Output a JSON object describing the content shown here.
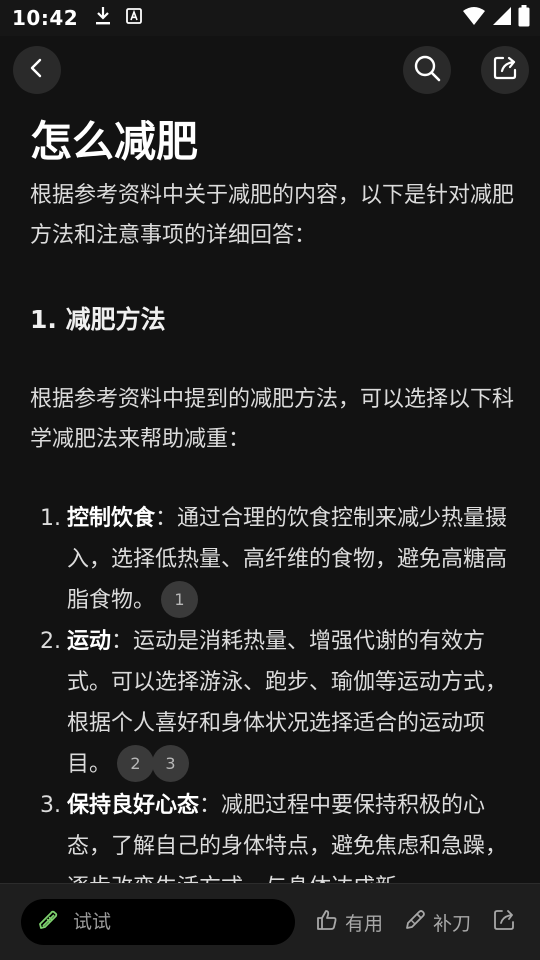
{
  "status": {
    "time": "10:42",
    "icons": [
      "download-icon",
      "keyboard-a-icon",
      "wifi-icon",
      "signal-icon",
      "battery-icon"
    ]
  },
  "nav": {
    "icons": [
      "back-icon",
      "search-icon",
      "share-icon"
    ]
  },
  "article": {
    "title": "怎么减肥",
    "intro": "根据参考资料中关于减肥的内容，以下是针对减肥方法和注意事项的详细回答：",
    "section1_heading": "1. 减肥方法",
    "section1_intro": "根据参考资料中提到的减肥方法，可以选择以下科学减肥法来帮助减重：",
    "items": [
      {
        "num": "1.",
        "term": "控制饮食",
        "sep": "：",
        "text": "通过合理的饮食控制来减少热量摄入，选择低热量、高纤维的食物，避免高糖高脂食物。",
        "cites": [
          "1"
        ]
      },
      {
        "num": "2.",
        "term": "运动",
        "sep": "：",
        "text": "运动是消耗热量、增强代谢的有效方式。可以选择游泳、跑步、瑜伽等运动方式，根据个人喜好和身体状况选择适合的运动项目。",
        "cites": [
          "2",
          "3"
        ]
      },
      {
        "num": "3.",
        "term": "保持良好心态",
        "sep": "：",
        "text": "减肥过程中要保持积极的心态，了解自己的身体特点，避免焦虑和急躁，逐步改变生活方式，与身体达成新",
        "cites": []
      }
    ]
  },
  "bottom": {
    "input_placeholder": "试试",
    "useful_label": "有用",
    "supplement_label": "补刀"
  },
  "colors": {
    "background": "#121212",
    "status_bar": "#161616",
    "bottom_bar": "#1e1e1e",
    "citation_badge": "#3a3a3a"
  }
}
